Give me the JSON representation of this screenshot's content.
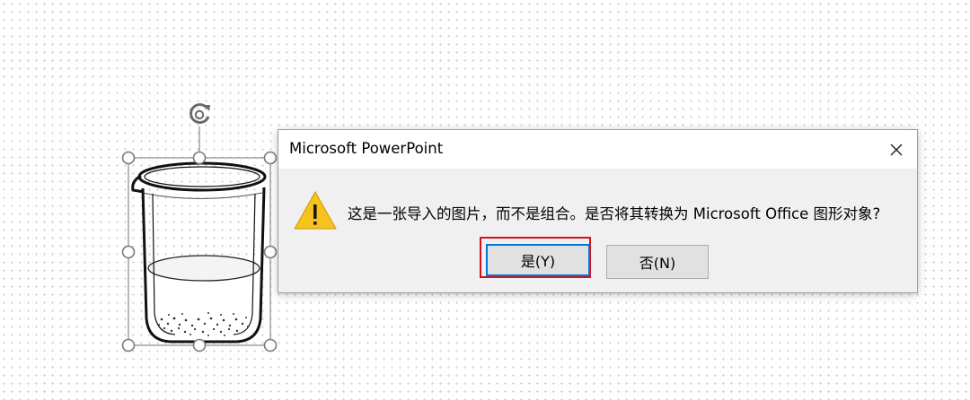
{
  "dialog": {
    "title": "Microsoft PowerPoint",
    "message": "这是一张导入的图片，而不是组合。是否将其转换为 Microsoft Office 图形对象?",
    "yes_label": "是(Y)",
    "no_label": "否(N)",
    "close_icon": "close-icon",
    "warning_icon": "warning-icon"
  },
  "colors": {
    "highlight": "#d0121b",
    "focus": "#0078d7",
    "warning": "#f6c21c"
  }
}
